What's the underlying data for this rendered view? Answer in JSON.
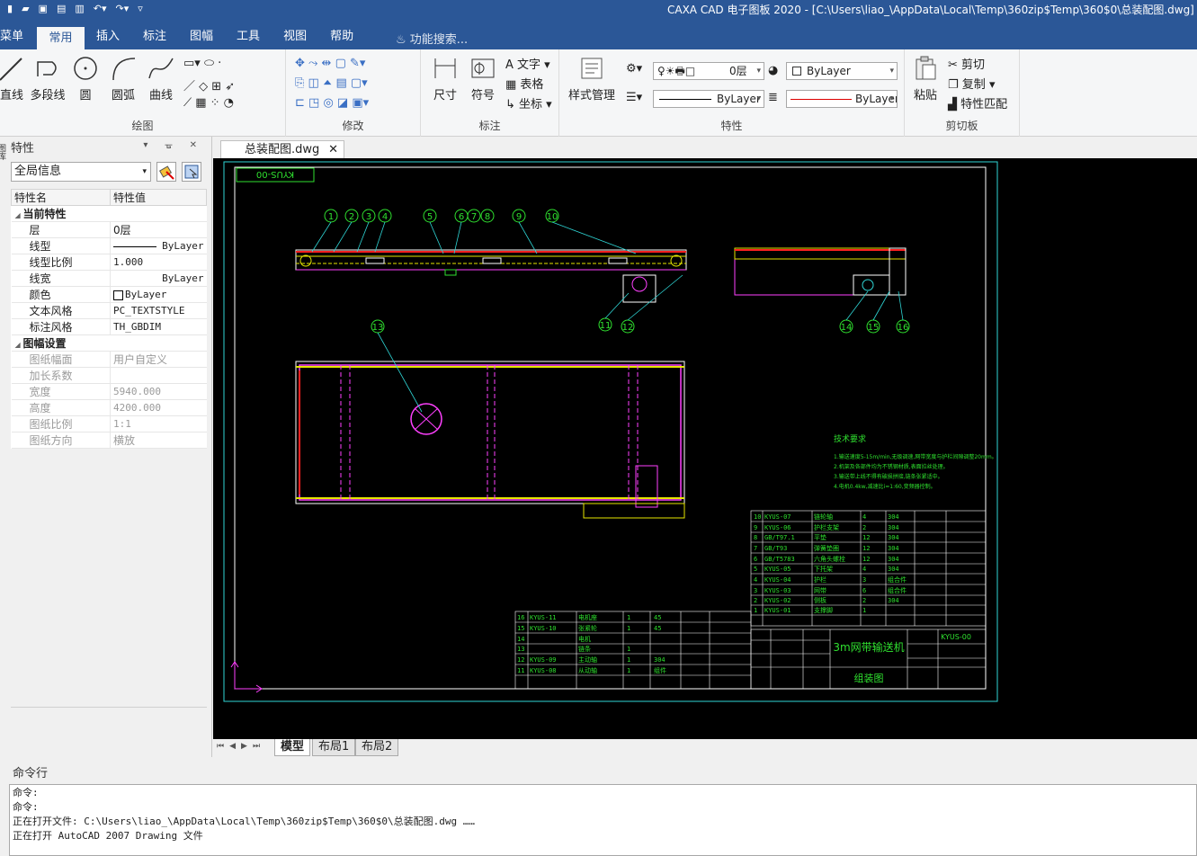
{
  "window": {
    "title": "CAXA CAD 电子图板 2020 - [C:\\Users\\liao_\\AppData\\Local\\Temp\\360zip$Temp\\360$0\\总装配图.dwg]"
  },
  "quick_access": [
    "new-icon",
    "open-icon",
    "save-icon",
    "saveas-icon",
    "print-icon",
    "undo-icon",
    "redo-icon",
    "customize-icon"
  ],
  "menu_tabs": [
    "菜单",
    "常用",
    "插入",
    "标注",
    "图幅",
    "工具",
    "视图",
    "帮助"
  ],
  "menu_active": "常用",
  "search_label": "功能搜索...",
  "ribbon": {
    "draw": {
      "label": "绘图",
      "tools": [
        "直线",
        "多段线",
        "圆",
        "圆弧",
        "曲线"
      ]
    },
    "modify": {
      "label": "修改"
    },
    "annotate": {
      "label": "标注",
      "tools": [
        "尺寸",
        "符号"
      ],
      "small": [
        "文字",
        "表格",
        "坐标"
      ]
    },
    "style": {
      "label": "样式管理"
    },
    "properties": {
      "label": "特性",
      "layer": "0层",
      "color": "ByLayer",
      "linetype": "ByLayer",
      "linewidth": "ByLayer"
    },
    "clipboard": {
      "label": "剪切板",
      "paste": "粘贴",
      "small": [
        "剪切",
        "复制",
        "特性匹配"
      ]
    }
  },
  "panel": {
    "title": "特性",
    "edge_label": "图库",
    "selector": "全局信息",
    "col_name": "特性名",
    "col_value": "特性值",
    "sections": [
      {
        "title": "当前特性",
        "rows": [
          {
            "name": "层",
            "value": "0层"
          },
          {
            "name": "线型",
            "value": "ByLayer"
          },
          {
            "name": "线型比例",
            "value": "1.000"
          },
          {
            "name": "线宽",
            "value": "ByLayer"
          },
          {
            "name": "颜色",
            "value": "ByLayer"
          },
          {
            "name": "文本风格",
            "value": "PC_TEXTSTYLE"
          },
          {
            "name": "标注风格",
            "value": "TH_GBDIM"
          }
        ]
      },
      {
        "title": "图幅设置",
        "rows": [
          {
            "name": "图纸幅面",
            "value": "用户自定义"
          },
          {
            "name": "加长系数",
            "value": ""
          },
          {
            "name": "宽度",
            "value": "5940.000"
          },
          {
            "name": "高度",
            "value": "4200.000"
          },
          {
            "name": "图纸比例",
            "value": "1:1"
          },
          {
            "name": "图纸方向",
            "value": "横放"
          }
        ]
      }
    ]
  },
  "document": {
    "tab": "总装配图.dwg",
    "layout_tabs": [
      "模型",
      "布局1",
      "布局2"
    ],
    "active_layout": "模型"
  },
  "drawing": {
    "code_box": "KYUS-00",
    "balloons": [
      "1",
      "2",
      "3",
      "4",
      "5",
      "6",
      "7",
      "8",
      "9",
      "10",
      "11",
      "12",
      "13",
      "14",
      "15",
      "16"
    ],
    "tech_title": "技术要求",
    "tech_lines": [
      "1.输送速度5-15m/min,无级调速,网带宽度与护栏间隙调整20mm。",
      "2.机架及各部件均为不锈钢材质,表面拉丝处理。",
      "3.输送带上线不得有破损拼接,链条张紧适中。",
      "4.电机0.4kw,减速比i=1:60,变频器控制。"
    ],
    "title_name": "3m网带输送机",
    "title_sub": "组装图",
    "drawing_no": "KYUS-00",
    "bom_right": [
      {
        "no": "10",
        "code": "KYUS-07",
        "name": "链轮轴",
        "qty": "4",
        "mat": "304"
      },
      {
        "no": "9",
        "code": "KYUS-06",
        "name": "护栏支架",
        "qty": "2",
        "mat": "304"
      },
      {
        "no": "8",
        "code": "GB/T97.1",
        "name": "平垫",
        "qty": "12",
        "mat": "304"
      },
      {
        "no": "7",
        "code": "GB/T93",
        "name": "弹簧垫圈",
        "qty": "12",
        "mat": "304"
      },
      {
        "no": "6",
        "code": "GB/T5783",
        "name": "六角头螺栓",
        "qty": "12",
        "mat": "304"
      },
      {
        "no": "5",
        "code": "KYUS-05",
        "name": "下托架",
        "qty": "4",
        "mat": "304"
      },
      {
        "no": "4",
        "code": "KYUS-04",
        "name": "护栏",
        "qty": "3",
        "mat": "组合件"
      },
      {
        "no": "3",
        "code": "KYUS-03",
        "name": "网带",
        "qty": "6",
        "mat": "组合件"
      },
      {
        "no": "2",
        "code": "KYUS-02",
        "name": "侧板",
        "qty": "2",
        "mat": "304"
      },
      {
        "no": "1",
        "code": "KYUS-01",
        "name": "支撑脚",
        "qty": "1",
        "mat": ""
      }
    ],
    "bom_left": [
      {
        "no": "16",
        "code": "KYUS-11",
        "name": "电机座",
        "qty": "1",
        "mat": "45"
      },
      {
        "no": "15",
        "code": "KYUS-10",
        "name": "张紧轮",
        "qty": "1",
        "mat": "45"
      },
      {
        "no": "14",
        "code": "",
        "name": "电机",
        "qty": "",
        "mat": ""
      },
      {
        "no": "13",
        "code": "",
        "name": "链条",
        "qty": "1",
        "mat": ""
      },
      {
        "no": "12",
        "code": "KYUS-09",
        "name": "主动轴",
        "qty": "1",
        "mat": "304"
      },
      {
        "no": "11",
        "code": "KYUS-08",
        "name": "从动轴",
        "qty": "1",
        "mat": "组件"
      }
    ]
  },
  "command": {
    "label": "命令行",
    "lines": [
      "命令:",
      "命令:",
      "正在打开文件: C:\\Users\\liao_\\AppData\\Local\\Temp\\360zip$Temp\\360$0\\总装配图.dwg ……",
      "正在打开 AutoCAD 2007 Drawing 文件"
    ]
  }
}
